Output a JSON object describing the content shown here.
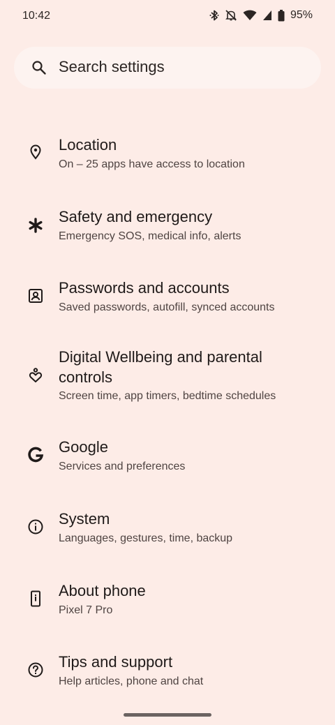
{
  "status_bar": {
    "time": "10:42",
    "battery": "95%",
    "icons": [
      "bluetooth-icon",
      "mute-icon",
      "wifi-icon",
      "signal-icon",
      "battery-icon"
    ]
  },
  "search": {
    "placeholder": "Search settings"
  },
  "settings": [
    {
      "title": "Location",
      "subtitle": "On – 25 apps have access to location",
      "icon": "location-pin-icon"
    },
    {
      "title": "Safety and emergency",
      "subtitle": "Emergency SOS, medical info, alerts",
      "icon": "asterisk-icon"
    },
    {
      "title": "Passwords and accounts",
      "subtitle": "Saved passwords, autofill, synced accounts",
      "icon": "account-box-icon"
    },
    {
      "title": "Digital Wellbeing and parental controls",
      "subtitle": "Screen time, app timers, bedtime schedules",
      "icon": "wellbeing-icon"
    },
    {
      "title": "Google",
      "subtitle": "Services and preferences",
      "icon": "google-g-icon"
    },
    {
      "title": "System",
      "subtitle": "Languages, gestures, time, backup",
      "icon": "info-icon"
    },
    {
      "title": "About phone",
      "subtitle": "Pixel 7 Pro",
      "icon": "phone-icon"
    },
    {
      "title": "Tips and support",
      "subtitle": "Help articles, phone and chat",
      "icon": "help-icon"
    }
  ],
  "colors": {
    "background": "#fdece7",
    "search_background": "#fdf3f0",
    "primary_text": "#1f1a19",
    "secondary_text": "#4f4442"
  }
}
